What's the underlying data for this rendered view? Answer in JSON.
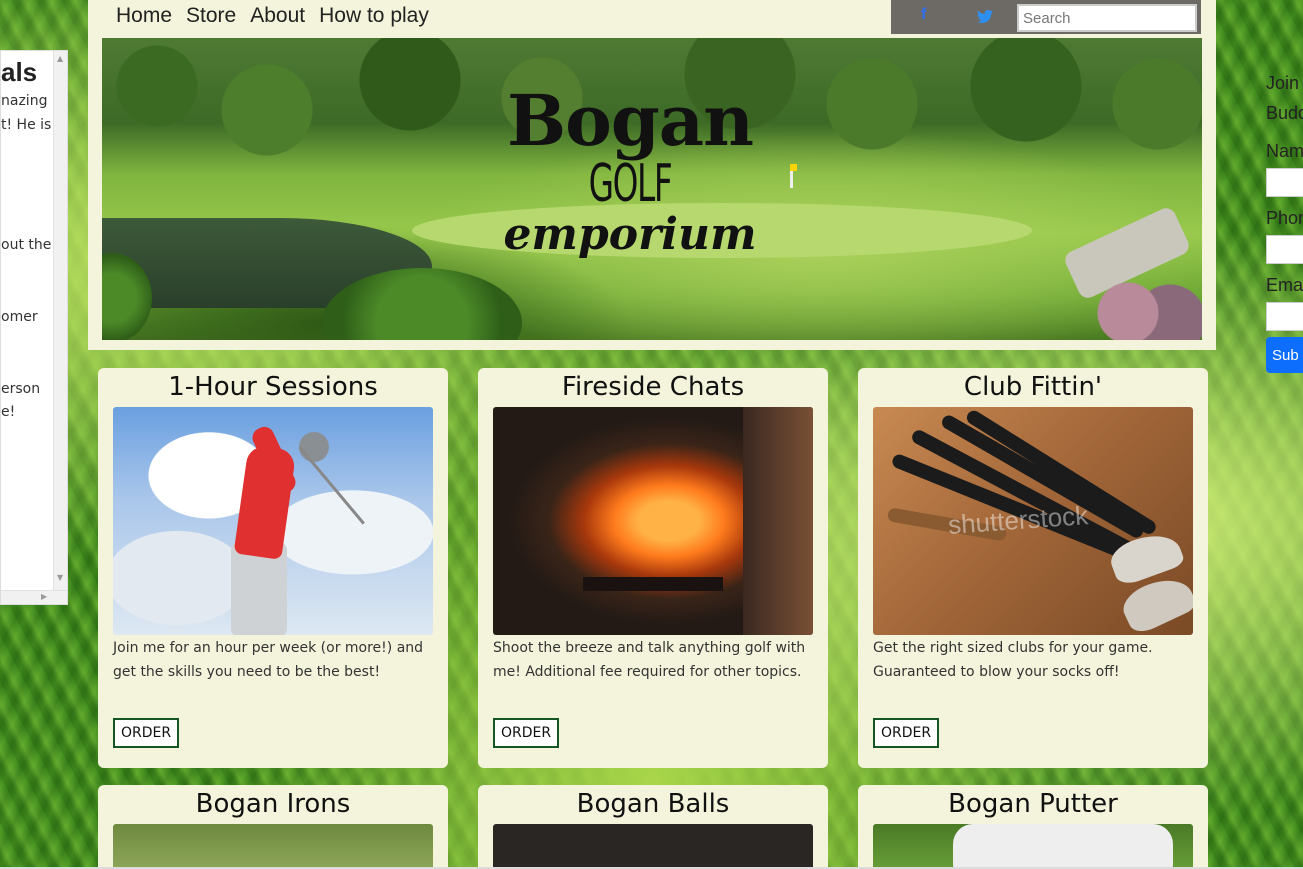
{
  "left_panel": {
    "title": "als",
    "lines": [
      "nazing",
      "t! He is",
      "out the",
      "omer",
      "erson",
      "e!"
    ]
  },
  "nav": {
    "items": [
      "Home",
      "Store",
      "About",
      "How to play"
    ]
  },
  "social": {
    "facebook_glyph": "f",
    "search_placeholder": "Search"
  },
  "logo": {
    "line1": "Bogan",
    "line2": "GOLF",
    "line3": "emporium"
  },
  "signup": {
    "intro_line1": "Join",
    "intro_line2": "Budd",
    "name_label": "Nam",
    "phone_label": "Phon",
    "email_label": "Ema",
    "submit_label": "Sub"
  },
  "cards": [
    {
      "title": "1-Hour Sessions",
      "description": "Join me for an hour per week (or more!) and get the skills you need to be the best!",
      "button": "ORDER"
    },
    {
      "title": "Fireside Chats",
      "description": "Shoot the breeze and talk anything golf with me! Additional fee required for other topics.",
      "button": "ORDER"
    },
    {
      "title": "Club Fittin'",
      "description": "Get the right sized clubs for your game. Guaranteed to blow your socks off!",
      "button": "ORDER",
      "watermark": "shutterstock"
    },
    {
      "title": "Bogan Irons"
    },
    {
      "title": "Bogan Balls"
    },
    {
      "title": "Bogan Putter"
    }
  ]
}
